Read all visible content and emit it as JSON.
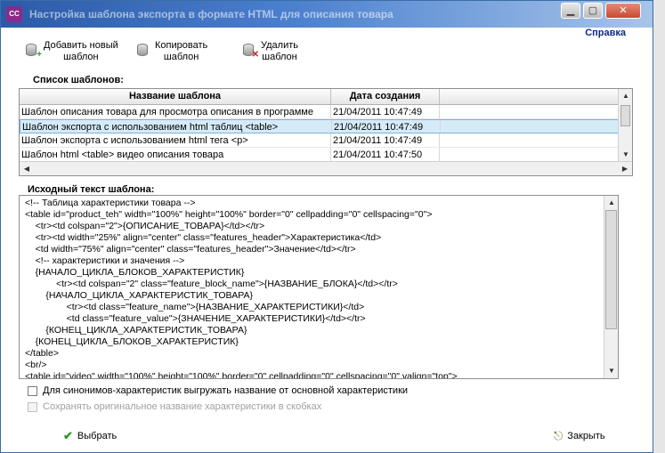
{
  "window": {
    "title": "Настройка шаблона экспорта в формате HTML для описания товара",
    "app_icon": "CC"
  },
  "help_link": "Справка",
  "toolbar": {
    "add": [
      "Добавить новый",
      "шаблон"
    ],
    "copy": [
      "Копировать",
      "шаблон"
    ],
    "delete": [
      "Удалить",
      "шаблон"
    ]
  },
  "templates": {
    "label": "Список шаблонов:",
    "columns": [
      "Название шаблона",
      "Дата создания"
    ],
    "rows": [
      {
        "name": "Шаблон описания товара для просмотра описания в программе",
        "date": "21/04/2011 10:47:49"
      },
      {
        "name": "Шаблон экспорта с использованием html таблиц <table>",
        "date": "21/04/2011 10:47:49"
      },
      {
        "name": "Шаблон экспорта с использованием html тега <p>",
        "date": "21/04/2011 10:47:49"
      },
      {
        "name": "Шаблон html <table> видео описания товара",
        "date": "21/04/2011 10:47:50"
      }
    ],
    "selected_index": 1
  },
  "source": {
    "label": "Исходный текст шаблона:",
    "lines": [
      "<!-- Таблица характеристики товара -->",
      "<table id=\"product_teh\" width=\"100%\" height=\"100%\" border=\"0\" cellpadding=\"0\" cellspacing=\"0\">",
      "    <tr><td colspan=\"2\">{ОПИСАНИЕ_ТОВАРА}</td></tr>",
      "    <tr><td width=\"25%\" align=\"center\" class=\"features_header\">Характеристика</td>",
      "    <td width=\"75%\" align=\"center\" class=\"features_header\">Значение</td></tr>",
      "    <!-- характеристики и значения -->",
      "    {НАЧАЛО_ЦИКЛА_БЛОКОВ_ХАРАКТЕРИСТИК}",
      "            <tr><td colspan=\"2\" class=\"feature_block_name\">{НАЗВАНИЕ_БЛОКА}</td></tr>",
      "        {НАЧАЛО_ЦИКЛА_ХАРАКТЕРИСТИК_ТОВАРА}",
      "                <tr><td class=\"feature_name\">{НАЗВАНИЕ_ХАРАКТЕРИСТИКИ}</td>",
      "                <td class=\"feature_value\">{ЗНАЧЕНИЕ_ХАРАКТЕРИСТИКИ}</td></tr>",
      "        {КОНЕЦ_ЦИКЛА_ХАРАКТЕРИСТИК_ТОВАРА}",
      "    {КОНЕЦ_ЦИКЛА_БЛОКОВ_ХАРАКТЕРИСТИК}",
      "</table>",
      "<br/>",
      "<table id=\"video\" width=\"100%\" height=\"100%\" border=\"0\" cellpadding=\"0\" cellspacing=\"0\" valign=\"top\">"
    ]
  },
  "options": {
    "synonyms": "Для синонимов-характеристик выгружать название от основной характеристики",
    "keep_original": "Сохранять оригинальное название характеристики в скобках"
  },
  "buttons": {
    "select": "Выбрать",
    "close": "Закрыть"
  },
  "background_fragments": {
    "ellipsis": "...",
    "left_glyphs": [
      "ф",
      "{"
    ]
  }
}
